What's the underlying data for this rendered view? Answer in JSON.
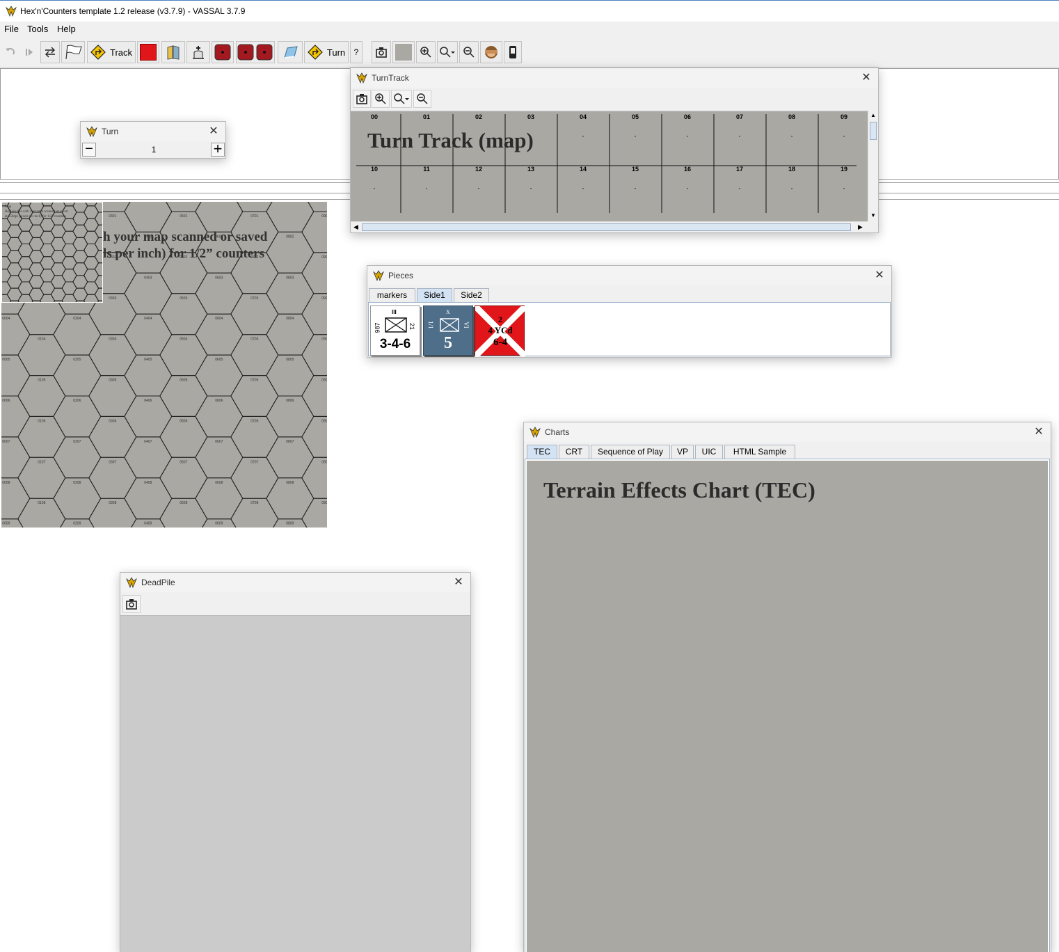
{
  "app": {
    "title": "Hex'n'Counters template 1.2 release (v3.7.9) - VASSAL 3.7.9"
  },
  "menu": {
    "file": "File",
    "tools": "Tools",
    "help": "Help"
  },
  "toolbar": {
    "track_label": "Track",
    "turn_label": "Turn",
    "help_label": "?"
  },
  "map": {
    "overview_text": [
      "Map",
      "Replace this with your map scanned or saved",
      "at 150dpi (pixels per inch) for 1/2\" counters"
    ],
    "main_text_line1": "h your map scanned or saved",
    "main_text_line2": "ls per inch) for 1/2” counters"
  },
  "turn_window": {
    "title": "Turn",
    "minus": "−",
    "value": "1",
    "plus": "+"
  },
  "turntrack_window": {
    "title": "TurnTrack",
    "map_title": "Turn Track (map)",
    "row1": [
      "00",
      "01",
      "02",
      "03",
      "04",
      "05",
      "06",
      "07",
      "08",
      "09"
    ],
    "row2": [
      "10",
      "11",
      "12",
      "13",
      "14",
      "15",
      "16",
      "17",
      "18",
      "19"
    ]
  },
  "pieces_window": {
    "title": "Pieces",
    "tabs": [
      "markers",
      "Side1",
      "Side2"
    ],
    "selected_tab": "Side1",
    "counter1": {
      "left_id": "987",
      "size": "III",
      "right_id": "21",
      "factors": "3-4-6"
    },
    "counter2": {
      "left_id": "1/1",
      "size": "X",
      "right_id": "VI",
      "factor": "5"
    },
    "counter3": {
      "size": "2",
      "id": "4 YCd",
      "factors": "6-4"
    }
  },
  "charts_window": {
    "title": "Charts",
    "tabs": [
      "TEC",
      "CRT",
      "Sequence of Play",
      "VP",
      "UIC",
      "HTML Sample"
    ],
    "selected_tab": "TEC",
    "heading": "Terrain Effects Chart (TEC)"
  },
  "deadpile_window": {
    "title": "DeadPile"
  },
  "colors": {
    "map_gray": "#a9a8a3",
    "counter_red": "#e0161a",
    "counter_blue": "#4e6e8a",
    "tab_selected": "#d4e3f4"
  }
}
